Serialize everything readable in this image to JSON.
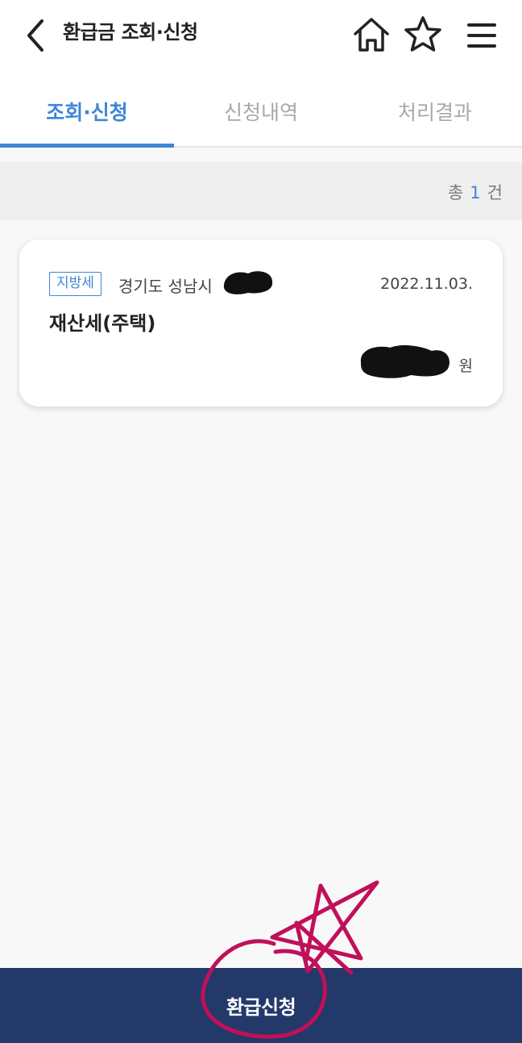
{
  "header": {
    "title": "환급금 조회·신청",
    "back_icon": "chevron-left-icon",
    "home_icon": "home-icon",
    "favorite_icon": "star-icon",
    "menu_icon": "hamburger-menu-icon"
  },
  "tabs": [
    {
      "label": "조회·신청",
      "active": true
    },
    {
      "label": "신청내역",
      "active": false
    },
    {
      "label": "처리결과",
      "active": false
    }
  ],
  "summary": {
    "prefix": "총",
    "count": "1",
    "suffix": "건"
  },
  "refund_items": [
    {
      "tax_type": "지방세",
      "region": "경기도 성남시 ",
      "date": "2022.11.03.",
      "tax_name": "재산세(주택)",
      "amount_unit": "원"
    }
  ],
  "bottom_action": {
    "label": "환급신청"
  },
  "colors": {
    "accent": "#3f86d6",
    "bottom_bar": "#22396a",
    "annotation": "#c0105a"
  }
}
